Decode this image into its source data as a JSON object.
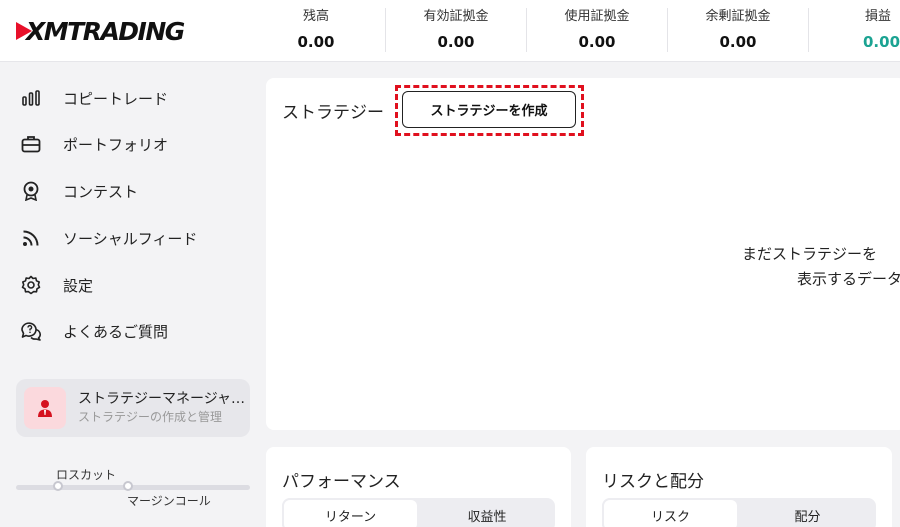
{
  "header": {
    "logo_text": "XMTRADING",
    "stats": [
      {
        "label": "残高",
        "value": "0.00"
      },
      {
        "label": "有効証拠金",
        "value": "0.00"
      },
      {
        "label": "使用証拠金",
        "value": "0.00"
      },
      {
        "label": "余剰証拠金",
        "value": "0.00"
      },
      {
        "label": "損益",
        "value": "0.00"
      }
    ],
    "positive_color": "#1ba392"
  },
  "sidebar": {
    "items": [
      {
        "label": "コピートレード",
        "icon": "bar-chart-icon"
      },
      {
        "label": "ポートフォリオ",
        "icon": "briefcase-icon"
      },
      {
        "label": "コンテスト",
        "icon": "award-icon"
      },
      {
        "label": "ソーシャルフィード",
        "icon": "rss-icon"
      },
      {
        "label": "設定",
        "icon": "gear-icon"
      },
      {
        "label": "よくあるご質問",
        "icon": "chat-question-icon"
      }
    ],
    "strategy_manager": {
      "title": "ストラテジーマネージャ…",
      "subtitle": "ストラテジーの作成と管理",
      "icon": "person-icon"
    },
    "leverage": {
      "top_label": "ロスカット",
      "bottom_label": "マージンコール"
    }
  },
  "main": {
    "strategy": {
      "title": "ストラテジー",
      "create_button": "ストラテジーを作成",
      "empty_line1": "まだストラテジーを",
      "empty_line2": "表示するデータ"
    },
    "performance": {
      "title": "パフォーマンス",
      "tabs": [
        "リターン",
        "収益性"
      ]
    },
    "risk": {
      "title": "リスクと配分",
      "tabs": [
        "リスク",
        "配分"
      ]
    },
    "accent_color": "#e0101e"
  }
}
